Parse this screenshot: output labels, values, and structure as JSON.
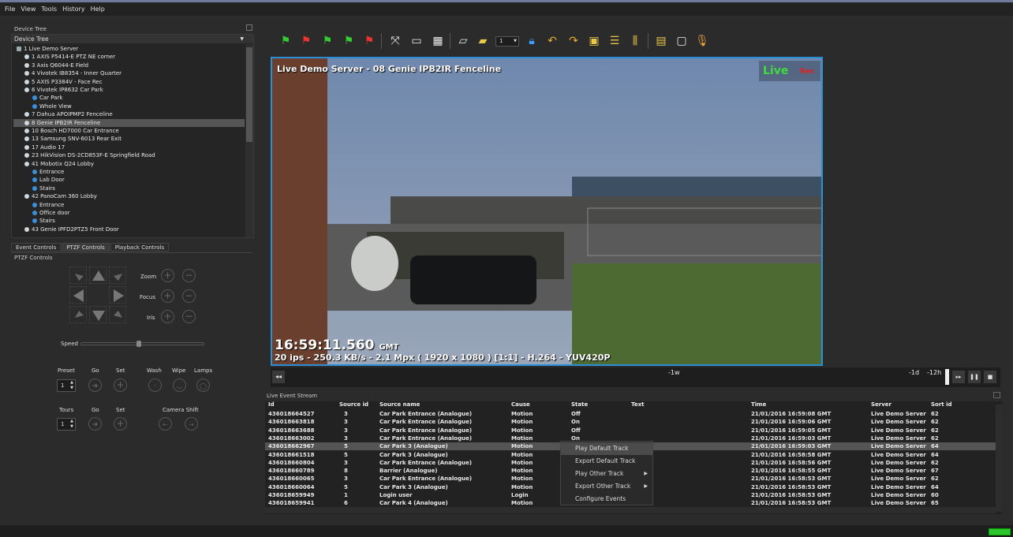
{
  "menu": [
    "File",
    "View",
    "Tools",
    "History",
    "Help"
  ],
  "device_tree": {
    "panel_title": "Device Tree",
    "header": "Device Tree",
    "items": [
      {
        "label": "1 Live Demo Server",
        "indent": 0,
        "icon": "server"
      },
      {
        "label": "1 AXIS P5414-E PTZ NE corner",
        "indent": 1,
        "icon": "camera"
      },
      {
        "label": "3 Axis Q6044-E Field",
        "indent": 1,
        "icon": "camera"
      },
      {
        "label": "4 Vivotek IB8354 - Inner Quarter",
        "indent": 1,
        "icon": "camera"
      },
      {
        "label": "5 AXIS P3384V - Face Rec",
        "indent": 1,
        "icon": "camera"
      },
      {
        "label": "6 Vivotek IP8632 Car Park",
        "indent": 1,
        "icon": "camera"
      },
      {
        "label": "Car Park",
        "indent": 2,
        "icon": "view"
      },
      {
        "label": "Whole View",
        "indent": 2,
        "icon": "view"
      },
      {
        "label": "7 Dahua APOIPMP2 Fenceline",
        "indent": 1,
        "icon": "camera"
      },
      {
        "label": "8 Genie IPB2IR Fenceline",
        "indent": 1,
        "icon": "camera",
        "selected": true
      },
      {
        "label": "10 Bosch HD7000 Car Entrance",
        "indent": 1,
        "icon": "camera"
      },
      {
        "label": "13 Samsung SNV-6013 Rear Exit",
        "indent": 1,
        "icon": "camera"
      },
      {
        "label": "17 Audio 17",
        "indent": 1,
        "icon": "audio"
      },
      {
        "label": "23 HikVision DS-2CD853F-E Springfield Road",
        "indent": 1,
        "icon": "camera"
      },
      {
        "label": "41 Mobotix Q24 Lobby",
        "indent": 1,
        "icon": "camera"
      },
      {
        "label": "Entrance",
        "indent": 2,
        "icon": "view"
      },
      {
        "label": "Lab Door",
        "indent": 2,
        "icon": "view"
      },
      {
        "label": "Stairs",
        "indent": 2,
        "icon": "view"
      },
      {
        "label": "42 PanoCam 360 Lobby",
        "indent": 1,
        "icon": "camera"
      },
      {
        "label": "Entrance",
        "indent": 2,
        "icon": "view"
      },
      {
        "label": "Office door",
        "indent": 2,
        "icon": "view"
      },
      {
        "label": "Stairs",
        "indent": 2,
        "icon": "view"
      },
      {
        "label": "43 Genie IPFD2PTZ5 Front Door",
        "indent": 1,
        "icon": "camera"
      }
    ]
  },
  "tabs": [
    "Event Controls",
    "PTZF Controls",
    "Playback Controls"
  ],
  "ptzf": {
    "title": "PTZF Controls",
    "zoom": "Zoom",
    "focus": "Focus",
    "iris": "Iris",
    "speed": "Speed",
    "speed_level": 0.47,
    "preset": "Preset",
    "go": "Go",
    "set": "Set",
    "wash": "Wash",
    "wipe": "Wipe",
    "lamps": "Lamps",
    "preset_value": "1",
    "tours": "Tours",
    "go2": "Go",
    "set2": "Set",
    "camera_shift": "Camera Shift",
    "tours_value": "1"
  },
  "toolbar": {
    "stream_number": "1"
  },
  "video": {
    "title": "Live Demo Server - 08 Genie IPB2IR Fenceline",
    "live": "Live",
    "rec": "Rec",
    "time": "16:59:11.560",
    "tz": "GMT",
    "info": "20 ips  -  250.3 KB/s  -  2.1 Mpx  ( 1920 x 1080 ) [1:1] -  H.264  -  YUV420P"
  },
  "timeline": {
    "label_1w": "-1w",
    "label_1d": "-1d",
    "label_12h": "-12h"
  },
  "events": {
    "title": "Live Event Stream",
    "columns": [
      "Id",
      "Source id",
      "Source name",
      "Cause",
      "State",
      "Text",
      "Time",
      "Server",
      "Sort id"
    ],
    "rows": [
      [
        "436018664527",
        "3",
        "Car Park Entrance (Analogue)",
        "Motion",
        "Off",
        "",
        "21/01/2016 16:59:08 GMT",
        "Live Demo Server",
        "62"
      ],
      [
        "436018663818",
        "3",
        "Car Park Entrance (Analogue)",
        "Motion",
        "On",
        "",
        "21/01/2016 16:59:06 GMT",
        "Live Demo Server",
        "62"
      ],
      [
        "436018663688",
        "3",
        "Car Park Entrance (Analogue)",
        "Motion",
        "Off",
        "",
        "21/01/2016 16:59:05 GMT",
        "Live Demo Server",
        "62"
      ],
      [
        "436018663002",
        "3",
        "Car Park Entrance (Analogue)",
        "Motion",
        "On",
        "",
        "21/01/2016 16:59:03 GMT",
        "Live Demo Server",
        "62"
      ],
      [
        "436018662967",
        "5",
        "Car Park 3 (Analogue)",
        "Motion",
        "",
        "",
        "21/01/2016 16:59:03 GMT",
        "Live Demo Server",
        "64"
      ],
      [
        "436018661518",
        "5",
        "Car Park 3 (Analogue)",
        "Motion",
        "",
        "",
        "21/01/2016 16:58:58 GMT",
        "Live Demo Server",
        "64"
      ],
      [
        "436018660804",
        "3",
        "Car Park Entrance (Analogue)",
        "Motion",
        "",
        "",
        "21/01/2016 16:58:56 GMT",
        "Live Demo Server",
        "62"
      ],
      [
        "436018660789",
        "8",
        "Barrier (Analogue)",
        "Motion",
        "",
        "",
        "21/01/2016 16:58:55 GMT",
        "Live Demo Server",
        "67"
      ],
      [
        "436018660065",
        "3",
        "Car Park Entrance (Analogue)",
        "Motion",
        "",
        "",
        "21/01/2016 16:58:53 GMT",
        "Live Demo Server",
        "62"
      ],
      [
        "436018660064",
        "5",
        "Car Park 3 (Analogue)",
        "Motion",
        "",
        "",
        "21/01/2016 16:58:53 GMT",
        "Live Demo Server",
        "64"
      ],
      [
        "436018659949",
        "1",
        "Login user",
        "Login",
        "",
        "",
        "21/01/2016 16:58:53 GMT",
        "Live Demo Server",
        "60"
      ],
      [
        "436018659941",
        "6",
        "Car Park 4 (Analogue)",
        "Motion",
        "Off",
        "",
        "21/01/2016 16:58:53 GMT",
        "Live Demo Server",
        "65"
      ]
    ],
    "selected_row": 4
  },
  "context_menu": [
    "Play Default Track",
    "Export Default Track",
    "Play Other Track",
    "Export Other Track",
    "Configure Events"
  ]
}
